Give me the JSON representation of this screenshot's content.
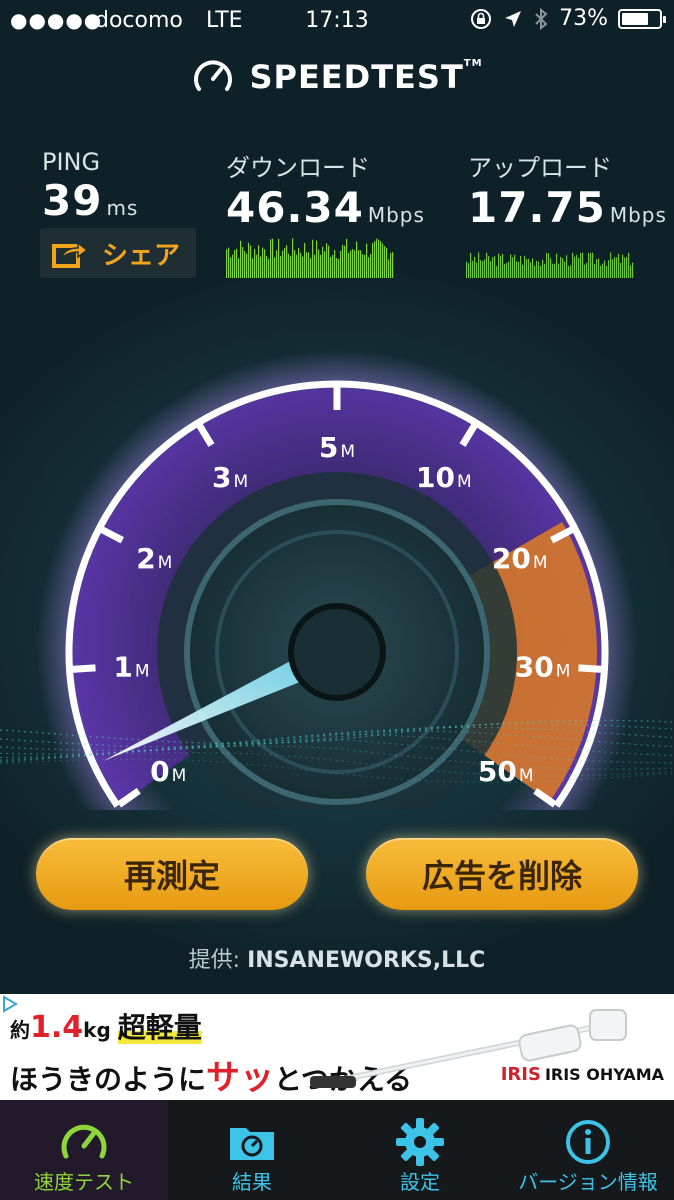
{
  "status_bar": {
    "signal": "●●●●●",
    "carrier": "docomo",
    "network": "LTE",
    "time": "17:13",
    "battery": "73%",
    "battery_level": 0.73
  },
  "header": {
    "title": "SPEEDTEST",
    "tm": "TM"
  },
  "stats": {
    "ping": {
      "label": "PING",
      "value": "39",
      "unit": "ms"
    },
    "download": {
      "label": "ダウンロード",
      "value": "46.34",
      "unit": "Mbps"
    },
    "upload": {
      "label": "アップロード",
      "value": "17.75",
      "unit": "Mbps"
    },
    "share_label": "シェア"
  },
  "gauge": {
    "ticks": [
      {
        "num": "0",
        "unit": "M"
      },
      {
        "num": "1",
        "unit": "M"
      },
      {
        "num": "2",
        "unit": "M"
      },
      {
        "num": "3",
        "unit": "M"
      },
      {
        "num": "5",
        "unit": "M"
      },
      {
        "num": "10",
        "unit": "M"
      },
      {
        "num": "20",
        "unit": "M"
      },
      {
        "num": "30",
        "unit": "M"
      },
      {
        "num": "50",
        "unit": "M"
      }
    ]
  },
  "buttons": {
    "retest": "再測定",
    "remove_ads": "広告を削除"
  },
  "provider": {
    "prefix": "提供: ",
    "name": "INSANEWORKS,LLC"
  },
  "ad": {
    "weight_prefix": "約",
    "weight_num": "1.4",
    "weight_unit": "kg",
    "light": "超軽量",
    "line2_a": "ほうきのように",
    "line2_b": "サッ",
    "line2_c": "とつかえる",
    "brand_logo": "IRIS",
    "brand": "IRIS OHYAMA"
  },
  "tabs": [
    {
      "label": "速度テスト",
      "icon": "speedometer-icon",
      "active": true
    },
    {
      "label": "結果",
      "icon": "results-folder-icon",
      "active": false
    },
    {
      "label": "設定",
      "icon": "gear-icon",
      "active": false
    },
    {
      "label": "バージョン情報",
      "icon": "info-icon",
      "active": false
    }
  ],
  "colors": {
    "accent": "#f2a51c",
    "tab_active": "#8fd63a",
    "tab_inactive": "#3ec3e8",
    "gauge_purple": "#6a3fb8",
    "gauge_orange": "#d7782a"
  }
}
